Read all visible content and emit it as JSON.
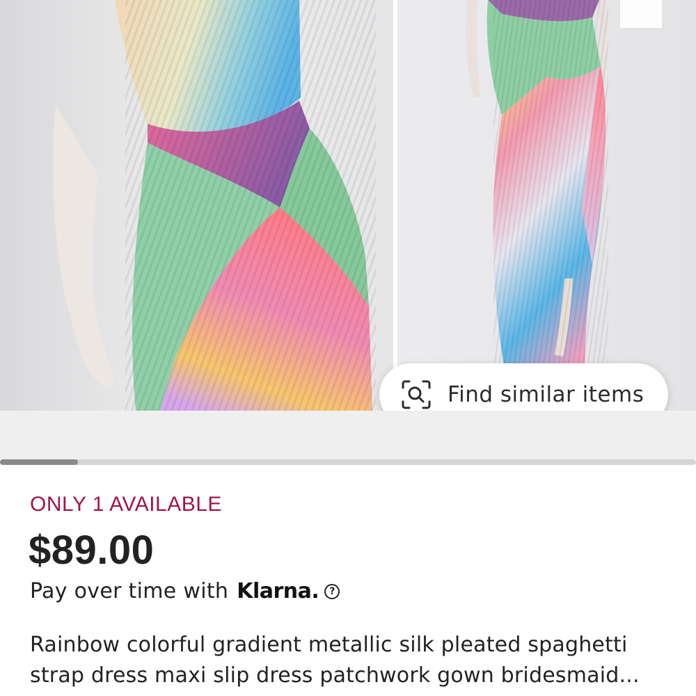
{
  "gallery": {
    "images": [
      {
        "name": "dress-photo-front"
      },
      {
        "name": "dress-photo-full"
      }
    ],
    "scroll_position_fraction": 0.0,
    "find_similar_label": "Find similar items",
    "find_similar_icon": "visual-search-icon"
  },
  "listing": {
    "availability": "ONLY 1 AVAILABLE",
    "price": "$89.00",
    "pay_text": "Pay over time with",
    "klarna_label": "Klarna.",
    "help_icon_glyph": "?",
    "title": "Rainbow colorful gradient metallic silk pleated spaghetti strap dress maxi slip dress patchwork gown bridesmaid..."
  },
  "colors": {
    "availability": "#a0144a",
    "text": "#222222",
    "background": "#ffffff"
  }
}
